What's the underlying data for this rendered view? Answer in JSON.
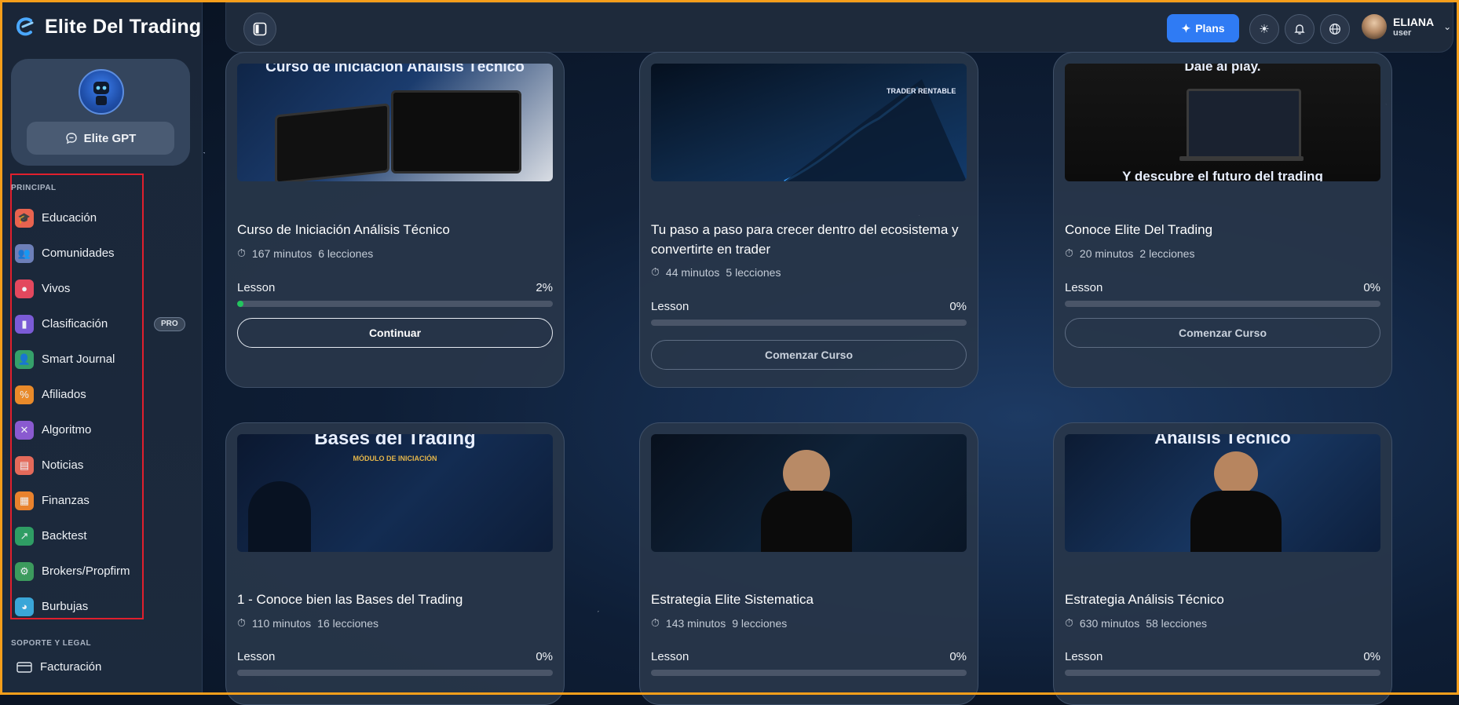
{
  "brand": {
    "title": "Elite Del Trading"
  },
  "gpt": {
    "button_label": "Elite GPT"
  },
  "sidebar": {
    "section_principal": "PRINCIPAL",
    "items": [
      {
        "label": "Educación",
        "icon": "graduation-cap-icon",
        "color": "#e8634f"
      },
      {
        "label": "Comunidades",
        "icon": "community-icon",
        "color": "#6d7fb8"
      },
      {
        "label": "Vivos",
        "icon": "live-icon",
        "color": "#e3485e"
      },
      {
        "label": "Clasificación",
        "icon": "ranking-icon",
        "color": "#7b5bd6",
        "badge": "PRO"
      },
      {
        "label": "Smart Journal",
        "icon": "journal-icon",
        "color": "#35a06a"
      },
      {
        "label": "Afiliados",
        "icon": "affiliates-icon",
        "color": "#e98a2a"
      },
      {
        "label": "Algoritmo",
        "icon": "algorithm-icon",
        "color": "#8a5ad0"
      },
      {
        "label": "Noticias",
        "icon": "news-icon",
        "color": "#e46a5a"
      },
      {
        "label": "Finanzas",
        "icon": "finance-icon",
        "color": "#e9822d"
      },
      {
        "label": "Backtest",
        "icon": "backtest-icon",
        "color": "#2f9d64"
      },
      {
        "label": "Brokers/Propfirm",
        "icon": "brokers-icon",
        "color": "#3c9a5d"
      },
      {
        "label": "Burbujas",
        "icon": "bubbles-icon",
        "color": "#3aa6d8"
      }
    ],
    "section_support": "SOPORTE Y LEGAL",
    "billing_label": "Facturación"
  },
  "topbar": {
    "plans_label": "Plans",
    "user_name": "ELIANA",
    "user_role": "user"
  },
  "courses": [
    {
      "thumb_caption": "Curso de Iniciación Análisis Técnico",
      "title": "Curso de Iniciación Análisis Técnico",
      "minutes": "167 minutos",
      "lessons": "6 lecciones",
      "lesson_label": "Lesson",
      "progress_text": "2%",
      "progress": 0.02,
      "button": "Continuar",
      "button_style": "primary"
    },
    {
      "thumb_caption": "TRADER RENTABLE",
      "title": "Tu paso a paso para crecer dentro del ecosistema y convertirte en trader",
      "minutes": "44 minutos",
      "lessons": "5 lecciones",
      "lesson_label": "Lesson",
      "progress_text": "0%",
      "progress": 0,
      "button": "Comenzar Curso",
      "button_style": "secondary"
    },
    {
      "thumb_caption": "Dale al play.",
      "thumb_caption2": "Y descubre el futuro del trading",
      "title": "Conoce Elite Del Trading",
      "minutes": "20 minutos",
      "lessons": "2 lecciones",
      "lesson_label": "Lesson",
      "progress_text": "0%",
      "progress": 0,
      "button": "Comenzar Curso",
      "button_style": "secondary"
    },
    {
      "thumb_caption": "Bases del Trading",
      "thumb_sub": "MÓDULO DE INICIACIÓN",
      "title": "1 - Conoce bien las Bases del Trading",
      "minutes": "110 minutos",
      "lessons": "16 lecciones",
      "lesson_label": "Lesson",
      "progress_text": "0%",
      "progress": 0
    },
    {
      "thumb_caption": "",
      "title": "Estrategia Elite Sistematica",
      "minutes": "143 minutos",
      "lessons": "9 lecciones",
      "lesson_label": "Lesson",
      "progress_text": "0%",
      "progress": 0
    },
    {
      "thumb_caption": "Análisis Técnico",
      "title": "Estrategia Análisis Técnico",
      "minutes": "630 minutos",
      "lessons": "58 lecciones",
      "lesson_label": "Lesson",
      "progress_text": "0%",
      "progress": 0
    }
  ]
}
